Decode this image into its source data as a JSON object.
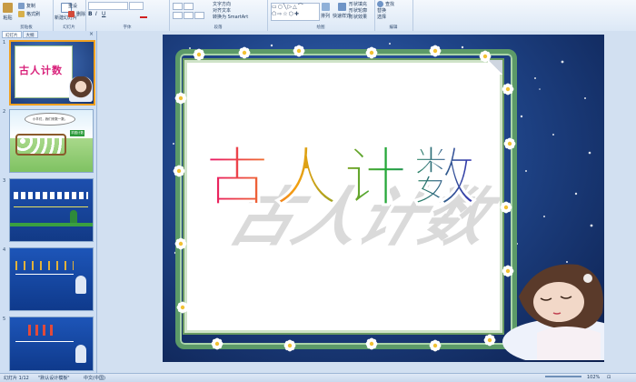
{
  "ribbon": {
    "clipboard": {
      "paste": "粘贴",
      "copy": "复制",
      "format_painter": "格式刷",
      "caption": "剪贴板"
    },
    "slides": {
      "new_slide": "新建幻灯片",
      "reset": "重设",
      "delete": "删除",
      "caption": "幻灯片"
    },
    "font": {
      "caption": "字体"
    },
    "paragraph": {
      "text_direction": "文字方向",
      "align_text": "对齐文本",
      "convert_smartart": "转换为 SmartArt",
      "caption": "段落"
    },
    "drawing": {
      "arrange": "排列",
      "quick_styles": "快速样式",
      "shape_fill": "形状填充",
      "shape_outline": "形状轮廓",
      "shape_effects": "形状效果",
      "caption": "绘图"
    },
    "editing": {
      "find": "查找",
      "replace": "替换",
      "select": "选择",
      "caption": "编辑"
    }
  },
  "panel": {
    "tabs": [
      "幻灯片",
      "大纲"
    ],
    "close": "×",
    "slides": [
      {
        "num": "1"
      },
      {
        "num": "2",
        "speech": "小羊们，我们来数一数。",
        "sign": "羊圈计数"
      },
      {
        "num": "3"
      },
      {
        "num": "4"
      },
      {
        "num": "5"
      }
    ]
  },
  "slide": {
    "title": "古人计数",
    "title_colors": [
      "#e8106a",
      "#f3a010",
      "#22a83a",
      "#3a2cc0"
    ]
  },
  "status": {
    "slide_count": "幻灯片 1/12",
    "theme": "\"默认设计模板\"",
    "language": "中文(中国)",
    "zoom": "102%"
  }
}
